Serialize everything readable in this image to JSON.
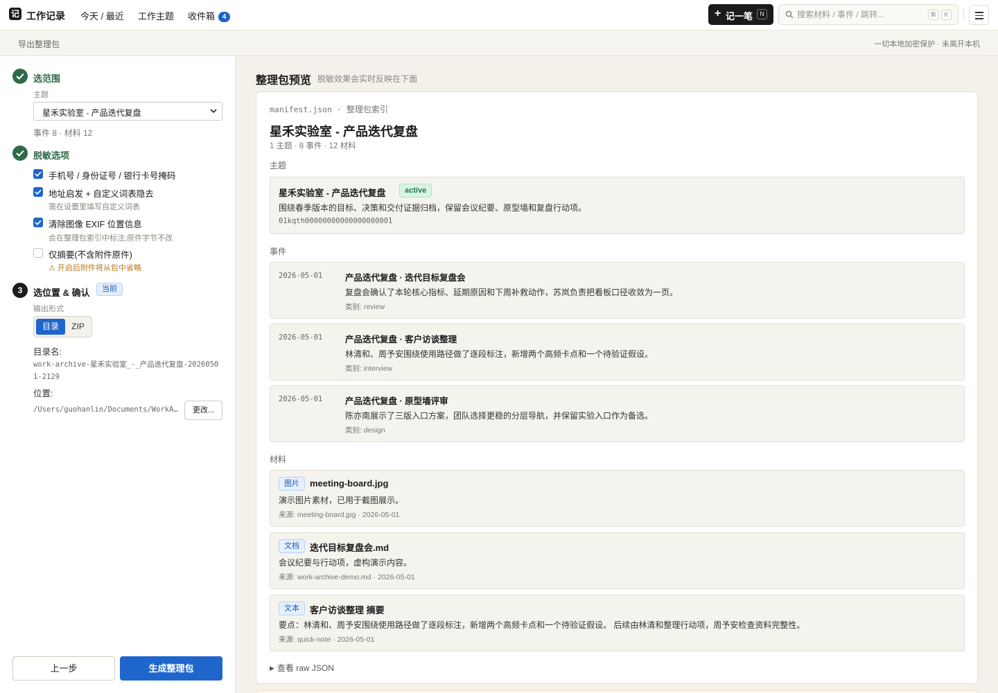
{
  "app": {
    "title": "工作记录",
    "logo_glyph": "记",
    "nav": [
      "今天 / 最近",
      "工作主题",
      "收件箱"
    ],
    "inbox_count": "4",
    "new_button": "记一笔",
    "new_shortcut": "N",
    "search_placeholder": "搜索材料 / 事件 / 跳转...",
    "search_shortcut": [
      "⌘",
      "K"
    ]
  },
  "subbar": {
    "breadcrumb": "导出整理包",
    "privacy_note": "一切本地加密保护 · 未离开本机"
  },
  "wizard": {
    "step1": {
      "title": "选范围",
      "field_label": "主题",
      "selected_topic": "星禾实验室 - 产品迭代复盘",
      "counts": "事件 8 · 材料 12"
    },
    "step2": {
      "title": "脱敏选项",
      "options": [
        {
          "label": "手机号 / 身份证号 / 银行卡号掩码",
          "hint": "",
          "checked": true
        },
        {
          "label": "地址启发 + 自定义词表隐去",
          "hint": "需在设置里填写自定义词表",
          "checked": true
        },
        {
          "label": "清除图像 EXIF 位置信息",
          "hint": "会在整理包索引中标注;原件字节不改",
          "checked": true
        },
        {
          "label": "仅摘要(不含附件原件)",
          "hint": "⚠ 开启后附件将从包中省略",
          "checked": false
        }
      ]
    },
    "step3": {
      "number": "3",
      "title": "选位置 & 确认",
      "current_badge": "当前",
      "format_label": "输出形式",
      "formats": [
        "目录",
        "ZIP"
      ],
      "dirname_label": "目录名:",
      "dirname": "work-archive-星禾实验室_-_产品迭代复盘-20260501-2129",
      "location_label": "位置:",
      "location": "/Users/guohanlin/Documents/WorkArchive",
      "change_button": "更改..."
    },
    "prev_button": "上一步",
    "generate_button": "生成整理包"
  },
  "preview": {
    "title": "整理包预览",
    "subtitle": "脱敏效果会实时反映在下面",
    "manifest_file": "manifest.json",
    "manifest_label": "整理包索引",
    "pack_title": "星禾实验室 - 产品迭代复盘",
    "pack_counts": "1 主题 · 8 事件 · 12 材料",
    "sections": {
      "topics": "主题",
      "events": "事件",
      "materials": "材料"
    },
    "topic": {
      "name": "星禾实验室 - 产品迭代复盘",
      "status": "active",
      "desc": "围绕春季版本的目标、决策和交付证据归档，保留会议纪要、原型墙和复盘行动项。",
      "id": "01kqth00000000000000000001"
    },
    "events": [
      {
        "date": "2026-05-01",
        "title": "产品迭代复盘 · 迭代目标复盘会",
        "desc": "复盘会确认了本轮核心指标、延期原因和下周补救动作，苏岚负责把看板口径收敛为一页。",
        "category": "类别: review"
      },
      {
        "date": "2026-05-01",
        "title": "产品迭代复盘 · 客户访谈整理",
        "desc": "林清和、周予安围绕使用路径做了逐段标注，新增两个高频卡点和一个待验证假设。",
        "category": "类别: interview"
      },
      {
        "date": "2026-05-01",
        "title": "产品迭代复盘 · 原型墙评审",
        "desc": "陈亦南展示了三版入口方案，团队选择更稳的分层导航，并保留实验入口作为备选。",
        "category": "类别: design"
      }
    ],
    "materials": [
      {
        "tag": "图片",
        "name": "meeting-board.jpg",
        "desc": "演示图片素材，已用于截图展示。",
        "source": "来源: meeting-board.jpg · 2026-05-01"
      },
      {
        "tag": "文档",
        "name": "迭代目标复盘会.md",
        "desc": "会议纪要与行动项，虚构演示内容。",
        "source": "来源: work-archive-demo.md · 2026-05-01"
      },
      {
        "tag": "文本",
        "name": "客户访谈整理 摘要",
        "desc": "要点：林清和、周予安围绕使用路径做了逐段标注，新增两个高频卡点和一个待验证假设。 后续由林清和整理行动项，周予安检查资料完整性。",
        "source": "来源: quick-note · 2026-05-01"
      }
    ],
    "raw_toggle": "查看 raw JSON"
  }
}
